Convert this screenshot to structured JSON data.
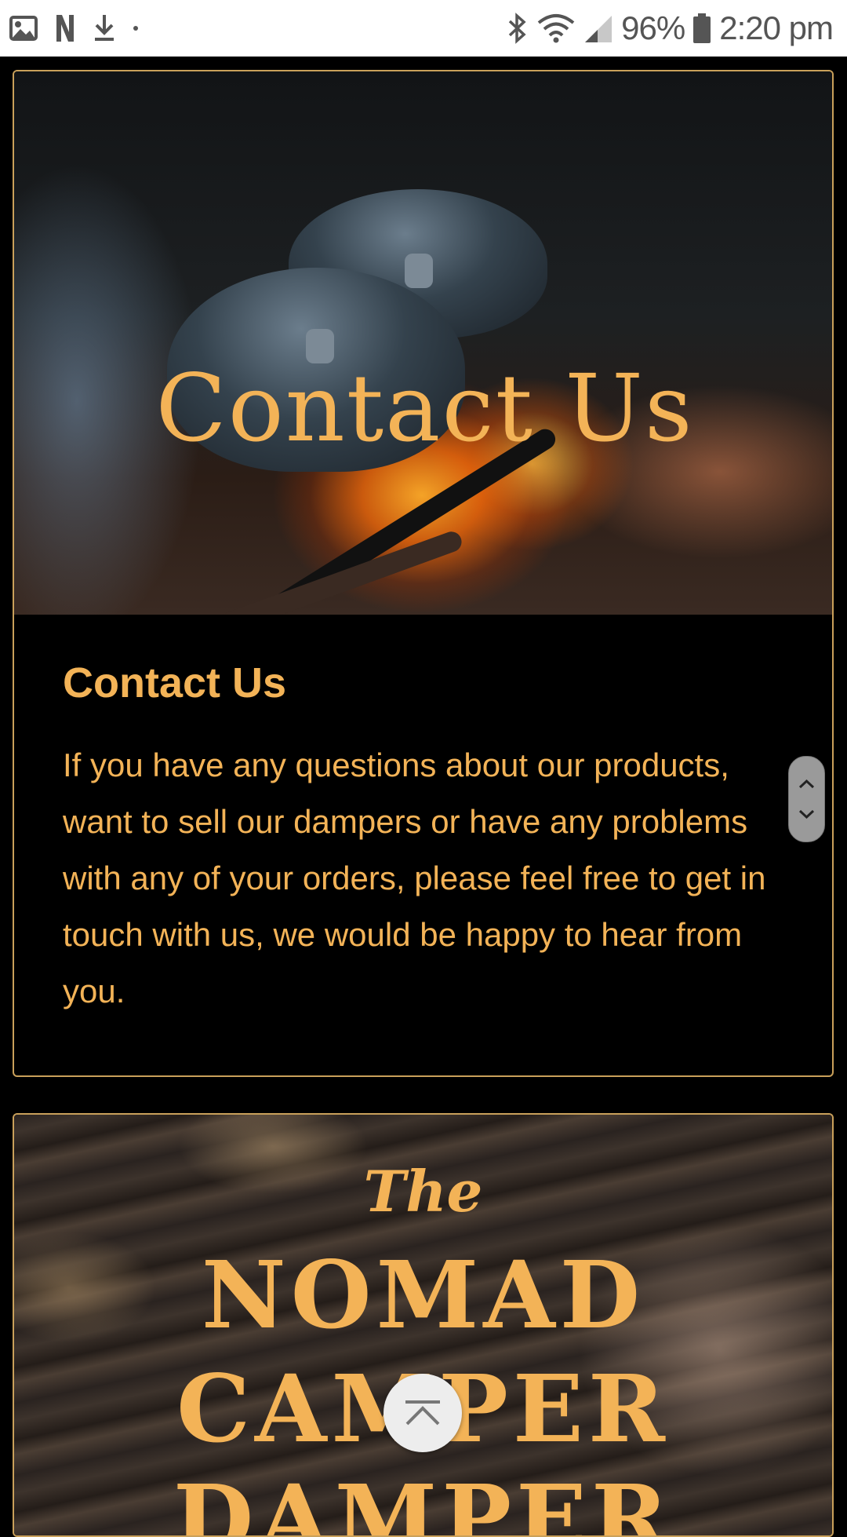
{
  "status_bar": {
    "battery_percent": "96%",
    "time": "2:20 pm",
    "left_icons": [
      "image-icon",
      "n-app-icon",
      "download-icon",
      "dot-icon"
    ],
    "right_icons": [
      "bluetooth-icon",
      "wifi-icon",
      "signal-icon",
      "battery-icon"
    ]
  },
  "contact_card": {
    "hero_title": "Contact Us",
    "heading": "Contact Us",
    "body": "If you have any questions about our products, want to sell our dampers or have any problems with any of your orders, please feel free to get in touch with us, we would be happy to hear from you."
  },
  "logo_card": {
    "line_the": "The",
    "line_1": "NOMAD",
    "line_2": "CAMPER",
    "line_3": "DAMPER"
  },
  "controls": {
    "scroll_icons": [
      "chevron-up-icon",
      "chevron-down-icon"
    ],
    "back_to_top_icon": "back-to-top-icon"
  },
  "colors": {
    "accent": "#f3b357",
    "card_border": "#c9a05a",
    "background": "#000000"
  }
}
